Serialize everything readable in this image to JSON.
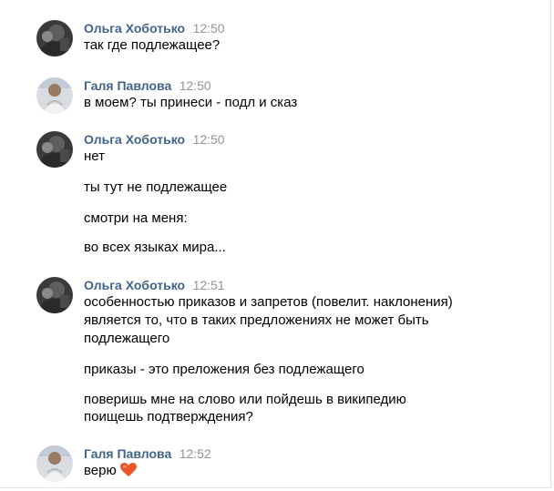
{
  "messages": [
    {
      "author": "Ольга Хоботько",
      "time": "12:50",
      "avatar": "avatar-olga",
      "lines": [
        "так где подлежащее?"
      ]
    },
    {
      "author": "Галя Павлова",
      "time": "12:50",
      "avatar": "avatar-galya",
      "lines": [
        "в моем? ты принеси - подл и сказ"
      ]
    },
    {
      "author": "Ольга Хоботько",
      "time": "12:50",
      "avatar": "avatar-olga",
      "lines": [
        "нет",
        "ты тут не подлежащее",
        "смотри на меня:",
        "во всех языках мира..."
      ]
    },
    {
      "author": "Ольга Хоботько",
      "time": "12:51",
      "avatar": "avatar-olga",
      "lines": [
        "особенностью приказов и запретов (повелит. наклонения)",
        "является то, что в таких предложениях не может быть",
        "подлежащего",
        "приказы - это преложения без подлежащего",
        "поверишь мне на слово или пойдешь в википедию",
        "поищешь подтверждения?"
      ]
    },
    {
      "author": "Галя Павлова",
      "time": "12:52",
      "avatar": "avatar-galya",
      "lines": [
        "верю"
      ],
      "emoji": "heart-icon"
    }
  ],
  "colors": {
    "author": "#42648b",
    "time": "#939393",
    "text": "#000000",
    "heart": "#e8582a"
  }
}
